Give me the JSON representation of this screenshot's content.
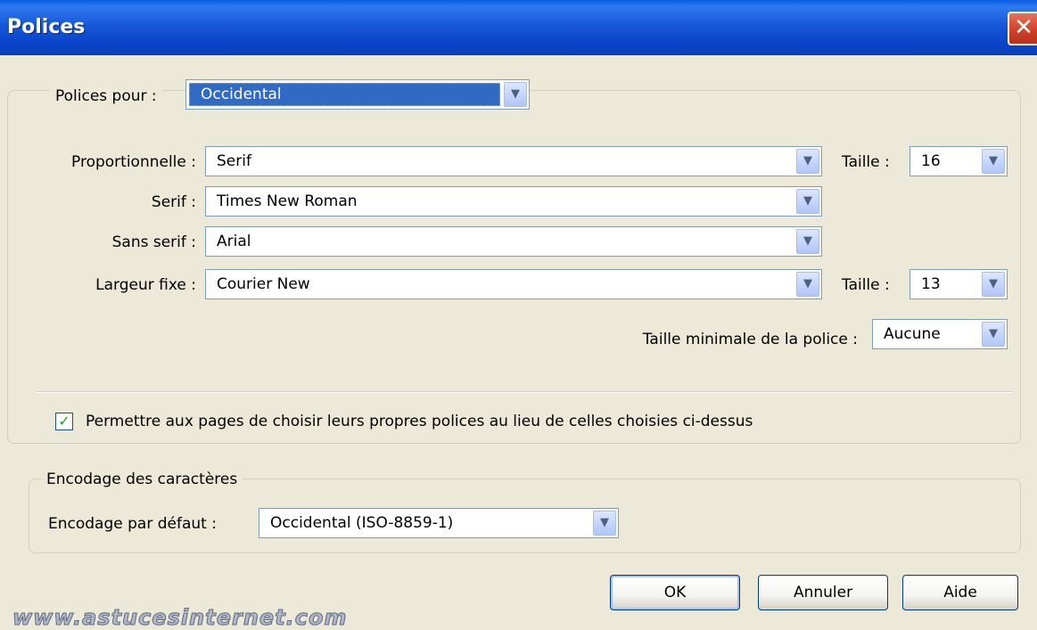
{
  "window": {
    "title": "Polices",
    "close_glyph": "✕"
  },
  "fonts_group": {
    "label": "Polices pour :",
    "language_value": "Occidental",
    "proportional": {
      "label": "Proportionnelle :",
      "value": "Serif",
      "size_label": "Taille :",
      "size_value": "16"
    },
    "serif": {
      "label": "Serif :",
      "value": "Times New Roman"
    },
    "sans_serif": {
      "label": "Sans serif :",
      "value": "Arial"
    },
    "monospace": {
      "label": "Largeur fixe :",
      "value": "Courier New",
      "size_label": "Taille :",
      "size_value": "13"
    },
    "min_size": {
      "label": "Taille minimale de la police :",
      "value": "Aucune"
    },
    "allow_pages_checkbox": {
      "label": "Permettre aux pages de choisir leurs propres polices au lieu de celles choisies ci-dessus",
      "checked": true
    }
  },
  "encoding_group": {
    "title": "Encodage des caractères",
    "default_label": "Encodage par défaut :",
    "default_value": "Occidental (ISO-8859-1)"
  },
  "buttons": {
    "ok": "OK",
    "cancel": "Annuler",
    "help": "Aide"
  },
  "watermark": "www.astucesinternet.com",
  "icons": {
    "dropdown": "chevron-down-icon",
    "check": "checkmark-icon",
    "close": "close-icon"
  }
}
